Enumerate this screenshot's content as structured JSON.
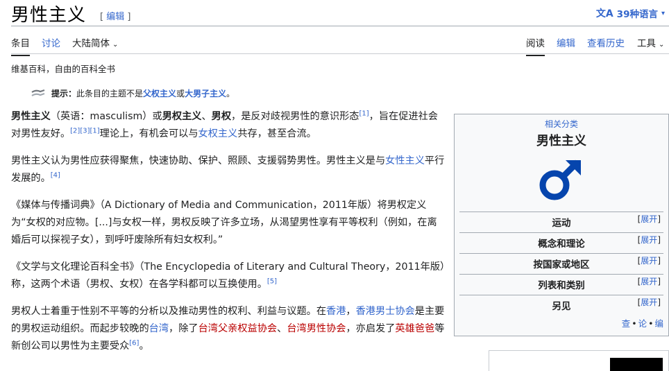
{
  "header": {
    "title": "男性主义",
    "edit_link": "编辑",
    "languages_label": "39种语言"
  },
  "tabs": {
    "article": "条目",
    "talk": "讨论",
    "variant": "大陆简体",
    "read": "阅读",
    "edit": "编辑",
    "history": "查看历史",
    "tools": "工具"
  },
  "tagline": "维基百科，自由的百科全书",
  "hatnote": {
    "label": "提示：",
    "text_before": "此条目的主题不是",
    "link1": "父权主义",
    "text_mid": "或",
    "link2": "大男子主义",
    "text_after": "。"
  },
  "paragraphs": {
    "p1": {
      "bold1": "男性主义",
      "t1": "（英语：masculism）或",
      "bold2": "男权主义",
      "t2": "、",
      "bold3": "男权",
      "t3": "，是反对歧视男性的意识形态",
      "ref1": "[1]",
      "t4": "，旨在促进社会对男性友好。",
      "ref2": "[2]",
      "ref3": "[3]",
      "ref4": "[1]",
      "t5": "理论上，有机会可以与",
      "link1": "女权主义",
      "t6": "共存，甚至合流。"
    },
    "p2": {
      "t1": "男性主义认为男性应获得聚焦，快速协助、保护、照顾、支援弱势男性。男性主义是与",
      "link1": "女性主义",
      "t2": "平行发展的。",
      "ref1": "[4]"
    },
    "p3": {
      "t1": "《媒体与传播词典》（A Dictionary of Media and Communication，2011年版）将男权定义为“女权的对应物。[...]与女权一样，男权反映了许多立场，从渴望男性享有平等权利（例如，在离婚后可以探视子女），到呼吁废除所有妇女权利。”"
    },
    "p4": {
      "t1": "《文学与文化理论百科全书》（The Encyclopedia of Literary and Cultural Theory，2011年版）称，这两个术语（男权、女权）在各学科都可以互换使用。",
      "ref1": "[5]"
    },
    "p5": {
      "t1": "男权人士着重于性别不平等的分析以及推动男性的权利、利益与议题。在",
      "link1": "香港",
      "t2": "，",
      "link2": "香港男士协会",
      "t3": "是主要的男权运动组织。而起步较晚的",
      "link3": "台湾",
      "t4": "，除了",
      "link4": "台湾父亲权益协会",
      "t5": "、",
      "link5": "台湾男性协会",
      "t6": "，亦启发了",
      "link6": "英雄爸爸",
      "t7": "等新创公司以男性为主要受众",
      "ref1": "[6]",
      "t8": "。"
    }
  },
  "infobox": {
    "series": "相关分类",
    "title": "男性主义",
    "symbol_color": "#0645ad",
    "rows": [
      {
        "label": "运动",
        "toggle": "展开"
      },
      {
        "label": "概念和理论",
        "toggle": "展开"
      },
      {
        "label": "按国家或地区",
        "toggle": "展开"
      },
      {
        "label": "列表和类别",
        "toggle": "展开"
      },
      {
        "label": "另见",
        "toggle": "展开"
      }
    ],
    "footer": {
      "view": "查",
      "talk": "论",
      "edit": "编"
    }
  },
  "colors": {
    "link": "#3366cc",
    "redlink": "#ba0000",
    "text": "#202122"
  }
}
